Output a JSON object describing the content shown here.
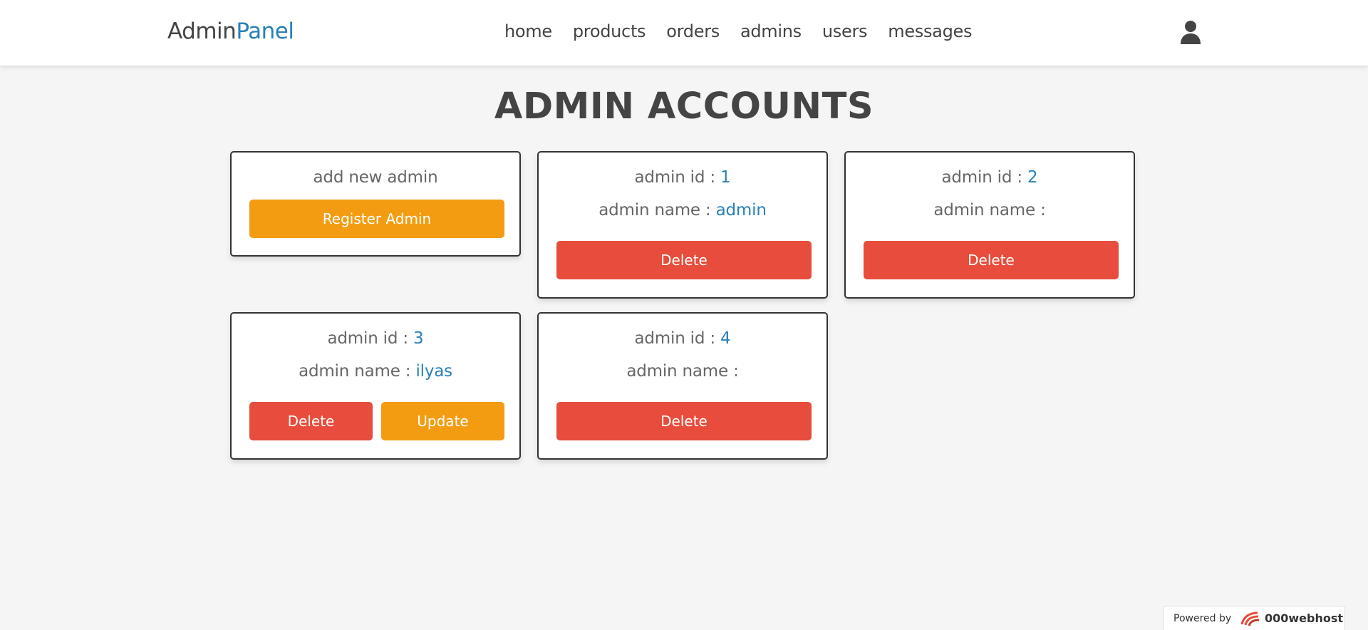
{
  "header": {
    "logo_main": "Admin",
    "logo_accent": "Panel",
    "nav": [
      "home",
      "products",
      "orders",
      "admins",
      "users",
      "messages"
    ],
    "user_icon": "user-icon"
  },
  "page_title": "ADMIN ACCOUNTS",
  "add_card": {
    "text": "add new admin",
    "button": "Register Admin"
  },
  "labels": {
    "admin_id": "admin id : ",
    "admin_name": "admin name : "
  },
  "admins": [
    {
      "id": "1",
      "name": "admin",
      "buttons": [
        "Delete"
      ]
    },
    {
      "id": "2",
      "name": "",
      "buttons": [
        "Delete"
      ]
    },
    {
      "id": "3",
      "name": "ilyas",
      "buttons": [
        "Delete",
        "Update"
      ]
    },
    {
      "id": "4",
      "name": "",
      "buttons": [
        "Delete"
      ]
    }
  ],
  "footer": {
    "powered_by": "Powered by",
    "host_name": "000webhost"
  },
  "colors": {
    "accent": "#2980b9",
    "orange": "#f39c12",
    "red": "#e74c3c",
    "background": "#f5f5f5"
  }
}
